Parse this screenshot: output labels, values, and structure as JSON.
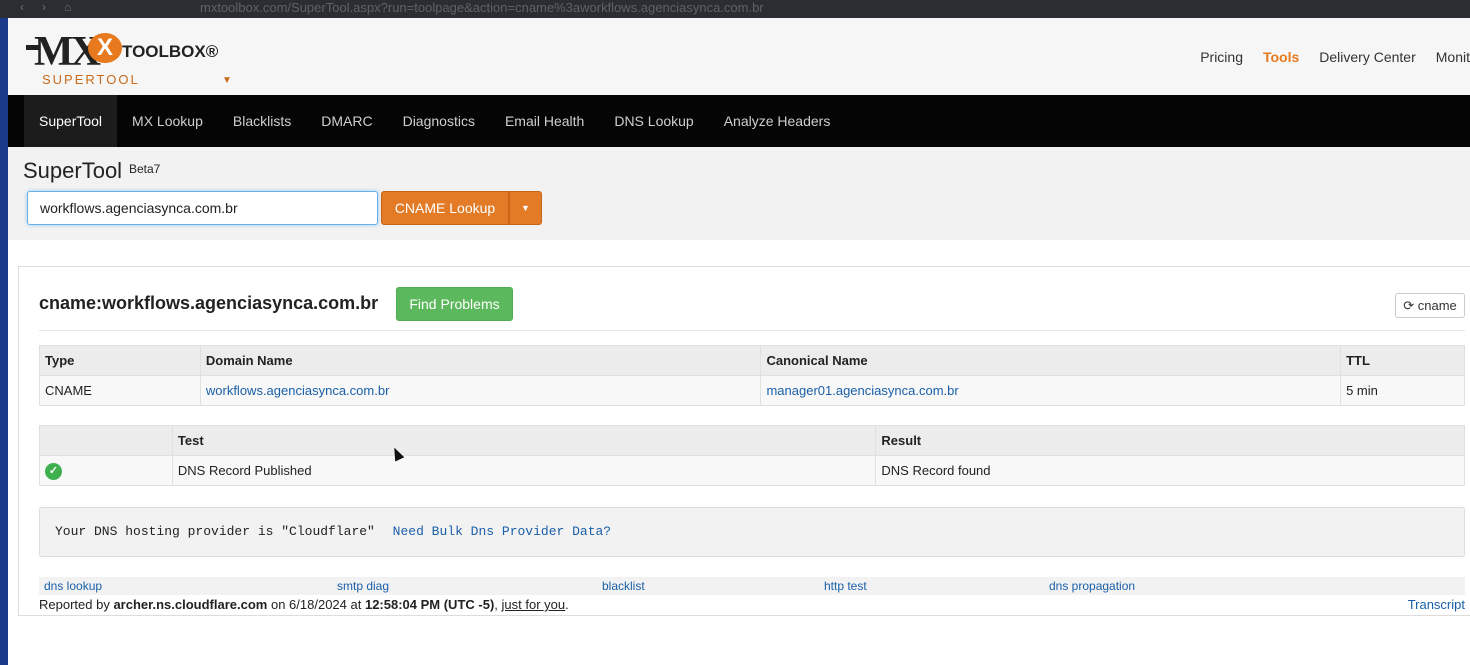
{
  "browser": {
    "url": "mxtoolbox.com/SuperTool.aspx?run=toolpage&action=cname%3aworkflows.agenciasynca.com.br"
  },
  "header": {
    "logo_mx": "MX",
    "logo_toolbox": "TOOLBOX®",
    "logo_supertool": "SUPERTOOL",
    "nav": [
      "Pricing",
      "Tools",
      "Delivery Center",
      "Monit"
    ],
    "nav_active": "Tools"
  },
  "menu": {
    "items": [
      "SuperTool",
      "MX Lookup",
      "Blacklists",
      "DMARC",
      "Diagnostics",
      "Email Health",
      "DNS Lookup",
      "Analyze Headers"
    ],
    "active": "SuperTool"
  },
  "supertool": {
    "title": "SuperTool",
    "beta": "Beta7",
    "input_value": "workflows.agenciasynca.com.br",
    "lookup_button": "CNAME Lookup"
  },
  "result": {
    "title": "cname:workflows.agenciasynca.com.br",
    "find_problems": "Find Problems",
    "refresh_button": "cname",
    "records_table": {
      "headers": [
        "Type",
        "Domain Name",
        "Canonical Name",
        "TTL"
      ],
      "rows": [
        [
          "CNAME",
          "workflows.agenciasynca.com.br",
          "manager01.agenciasynca.com.br",
          "5 min"
        ]
      ]
    },
    "tests_table": {
      "headers": [
        "",
        "Test",
        "Result"
      ],
      "rows": [
        [
          "",
          "DNS Record Published",
          "DNS Record found"
        ]
      ]
    },
    "provider_text": "Your DNS hosting provider is \"Cloudflare\"",
    "provider_link": "Need Bulk Dns Provider Data?",
    "quick_links": [
      "dns lookup",
      "smtp diag",
      "blacklist",
      "http test",
      "dns propagation"
    ],
    "reported_prefix": "Reported by",
    "reported_server": "archer.ns.cloudflare.com",
    "reported_on": "on 6/18/2024 at",
    "reported_time": "12:58:04 PM (UTC -5)",
    "reported_sep": ",",
    "just_for_you": "just for you",
    "reported_end": ".",
    "transcript": "Transcript"
  },
  "colors": {
    "accent": "#e77a1e",
    "success": "#5cb85c",
    "link": "#1a5fa8",
    "menu_bg": "#050505"
  }
}
